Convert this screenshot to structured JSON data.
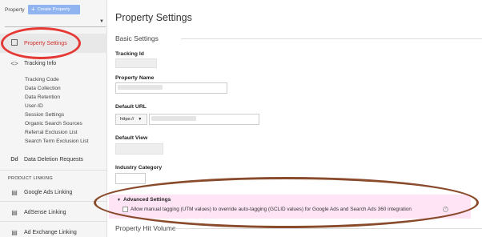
{
  "sidebar": {
    "property_label": "Property",
    "create_property_label": "Create Property",
    "active_item": {
      "label": "Property Settings",
      "icon": "settings-page-icon"
    },
    "tracking_info": {
      "label": "Tracking Info",
      "icon": "code-brackets-icon"
    },
    "tracking_sub_items": [
      "Tracking Code",
      "Data Collection",
      "Data Retention",
      "User-ID",
      "Session Settings",
      "Organic Search Sources",
      "Referral Exclusion List",
      "Search Term Exclusion List"
    ],
    "data_deletion": {
      "label": "Data Deletion Requests",
      "icon_text": "Dd"
    },
    "product_linking_heading": "PRODUCT LINKING",
    "product_links": [
      {
        "label": "Google Ads Linking",
        "icon": "google-ads-icon"
      },
      {
        "label": "AdSense Linking",
        "icon": "adsense-icon"
      },
      {
        "label": "Ad Exchange Linking",
        "icon": "ad-exchange-icon"
      }
    ]
  },
  "main": {
    "title": "Property Settings",
    "basic_settings_heading": "Basic Settings",
    "tracking_id_label": "Tracking Id",
    "property_name_label": "Property Name",
    "default_url_label": "Default URL",
    "url_protocol": "https://",
    "default_view_label": "Default View",
    "industry_category_label": "Industry Category",
    "advanced_settings_heading": "Advanced Settings",
    "manual_tagging_label": "Allow manual tagging (UTM values) to override auto-tagging (GCLID values) for Google Ads and Search Ads 360 integration",
    "manual_tagging_checked": false,
    "help_icon_text": "?",
    "hit_volume_heading": "Property Hit Volume"
  },
  "annotations": {
    "red_circle_color": "#e53935",
    "brown_circle_color": "#8a4b2c",
    "highlight_color": "#ffb3e6"
  }
}
